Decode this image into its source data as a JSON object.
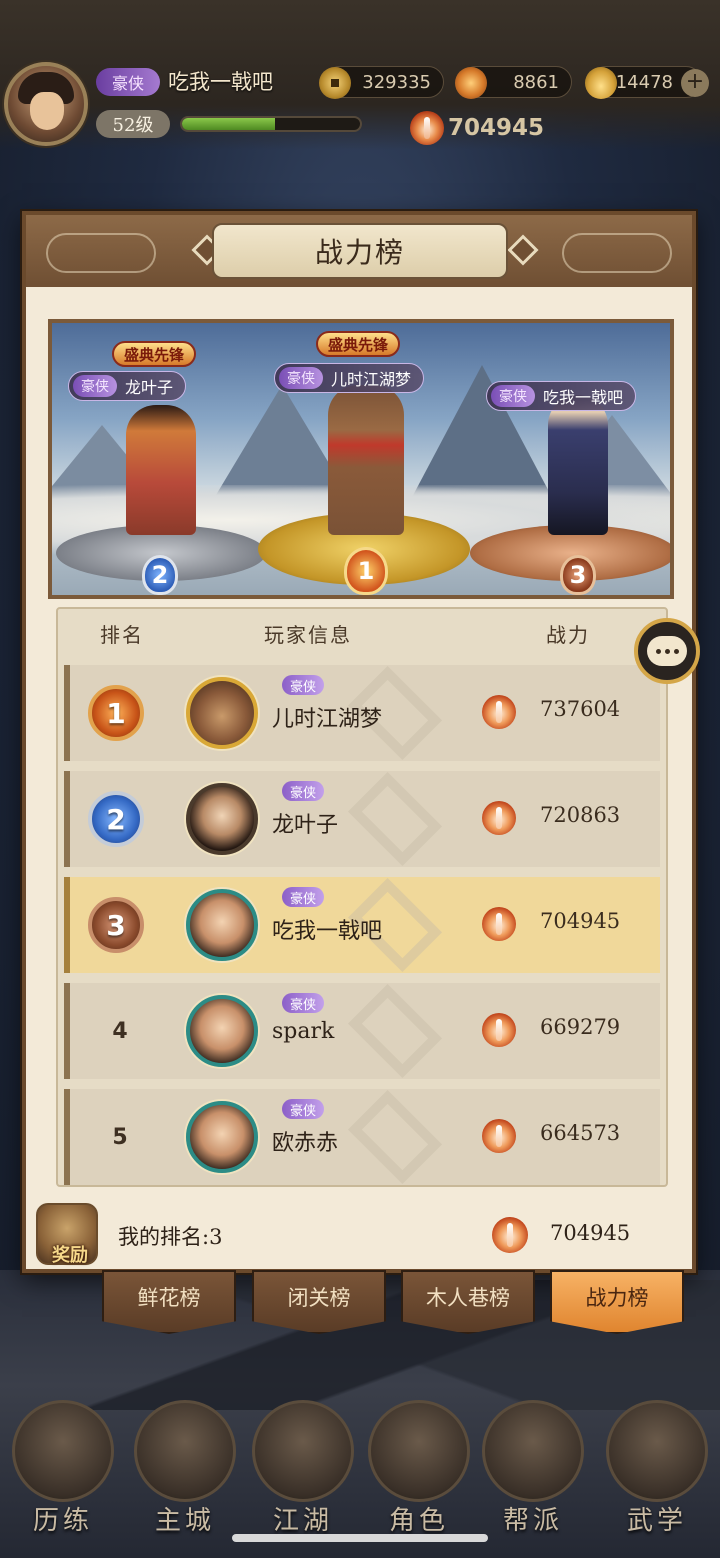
{
  "player": {
    "title_tag": "豪侠",
    "name": "吃我一戟吧",
    "level": "52级",
    "exp_progress": 0.52,
    "power": "704945"
  },
  "resources": [
    {
      "icon": "coin-icon",
      "value": "329335"
    },
    {
      "icon": "flame-icon",
      "value": "8861"
    },
    {
      "icon": "ingot-icon",
      "value": "14478",
      "add": "+"
    }
  ],
  "panel": {
    "title": "战力榜"
  },
  "podium": [
    {
      "rank": "2",
      "tag": "豪侠",
      "name": "龙叶子",
      "event": "盛典先锋"
    },
    {
      "rank": "1",
      "tag": "豪侠",
      "name": "儿时江湖梦",
      "event": "盛典先锋"
    },
    {
      "rank": "3",
      "tag": "豪侠",
      "name": "吃我一戟吧"
    }
  ],
  "table": {
    "headers": {
      "rank": "排名",
      "info": "玩家信息",
      "power": "战力"
    },
    "rows": [
      {
        "rank": "1",
        "tag": "豪侠",
        "name": "儿时江湖梦",
        "power": "737604"
      },
      {
        "rank": "2",
        "tag": "豪侠",
        "name": "龙叶子",
        "power": "720863"
      },
      {
        "rank": "3",
        "tag": "豪侠",
        "name": "吃我一戟吧",
        "power": "704945"
      },
      {
        "rank": "4",
        "tag": "豪侠",
        "name": "spark",
        "power": "669279"
      },
      {
        "rank": "5",
        "tag": "豪侠",
        "name": "欧赤赤",
        "power": "664573"
      }
    ]
  },
  "my_rank": {
    "reward_label": "奖励",
    "text": "我的排名:3",
    "power": "704945"
  },
  "rank_tabs": [
    {
      "label": "鲜花榜",
      "active": false
    },
    {
      "label": "闭关榜",
      "active": false
    },
    {
      "label": "木人巷榜",
      "active": false
    },
    {
      "label": "战力榜",
      "active": true
    }
  ],
  "bottom_nav": [
    {
      "label": "历练"
    },
    {
      "label": "主城"
    },
    {
      "label": "江湖"
    },
    {
      "label": "角色"
    },
    {
      "label": "帮派"
    },
    {
      "label": "武学"
    }
  ]
}
